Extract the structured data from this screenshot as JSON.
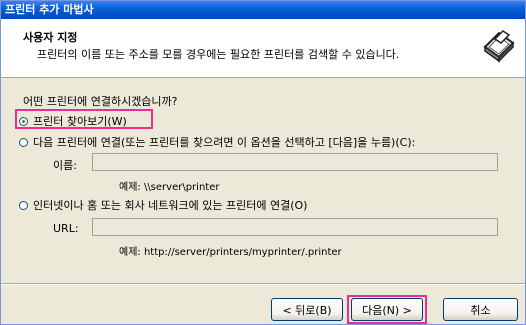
{
  "window": {
    "title": "프린터 추가 마법사"
  },
  "header": {
    "title": "사용자 지정",
    "subtitle": "프린터의 이름 또는 주소를 모를 경우에는 필요한 프린터를 검색할 수 있습니다.",
    "icon": "printer-wizard-icon"
  },
  "content": {
    "question": "어떤 프린터에 연결하시겠습니까?",
    "options": [
      {
        "label": "프린터 찾아보기(W)",
        "selected": true
      },
      {
        "label": "다음 프린터에 연결(또는 프린터를 찾으려면 이 옵션을 선택하고 [다음]을 누름)(C):",
        "selected": false
      },
      {
        "label": "인터넷이나 홈 또는 회사 네트워크에 있는 프린터에 연결(O)",
        "selected": false
      }
    ],
    "name_field": {
      "label": "이름:",
      "value": "",
      "example": "예제: \\\\server\\printer"
    },
    "url_field": {
      "label": "URL:",
      "value": "",
      "example": "예제: http://server/printers/myprinter/.printer"
    }
  },
  "buttons": {
    "back": "< 뒤로(B)",
    "next": "다음(N) >",
    "cancel": "취소"
  },
  "colors": {
    "highlight": "#ee2e8c",
    "titlebar": "#0a5fd8",
    "dialog_bg": "#ece9d8"
  }
}
